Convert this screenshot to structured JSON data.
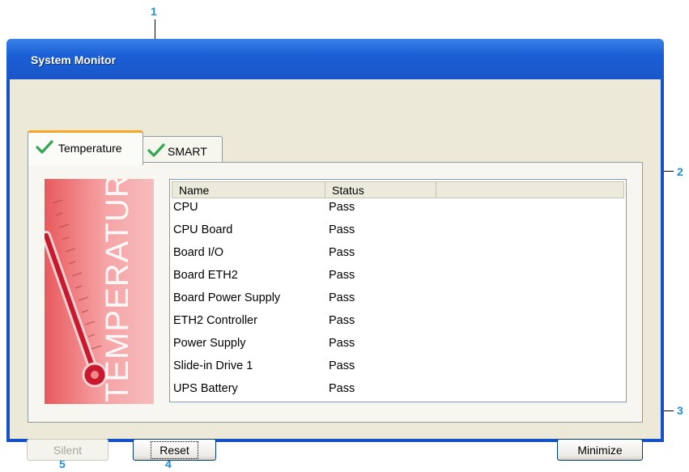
{
  "window": {
    "title": "System Monitor"
  },
  "tabs": [
    {
      "label": "Temperature",
      "icon": "checkmark-icon",
      "active": true
    },
    {
      "label": "SMART",
      "icon": "checkmark-icon",
      "active": false
    }
  ],
  "banner": {
    "text": "TEMPERATURE"
  },
  "list": {
    "columns": [
      "Name",
      "Status",
      ""
    ],
    "rows": [
      {
        "name": "CPU",
        "status": "Pass"
      },
      {
        "name": "CPU Board",
        "status": "Pass"
      },
      {
        "name": "Board I/O",
        "status": "Pass"
      },
      {
        "name": "Board ETH2",
        "status": "Pass"
      },
      {
        "name": "Board Power Supply",
        "status": "Pass"
      },
      {
        "name": "ETH2 Controller",
        "status": "Pass"
      },
      {
        "name": "Power Supply",
        "status": "Pass"
      },
      {
        "name": "Slide-in Drive 1",
        "status": "Pass"
      },
      {
        "name": "UPS Battery",
        "status": "Pass"
      }
    ]
  },
  "buttons": {
    "silent": "Silent",
    "reset": "Reset",
    "minimize": "Minimize"
  },
  "callouts": [
    "1",
    "2",
    "3",
    "4",
    "5"
  ],
  "colors": {
    "accent": "#1e8fd6",
    "titlebar": "#1b5fd6",
    "check": "#2fa84f"
  }
}
